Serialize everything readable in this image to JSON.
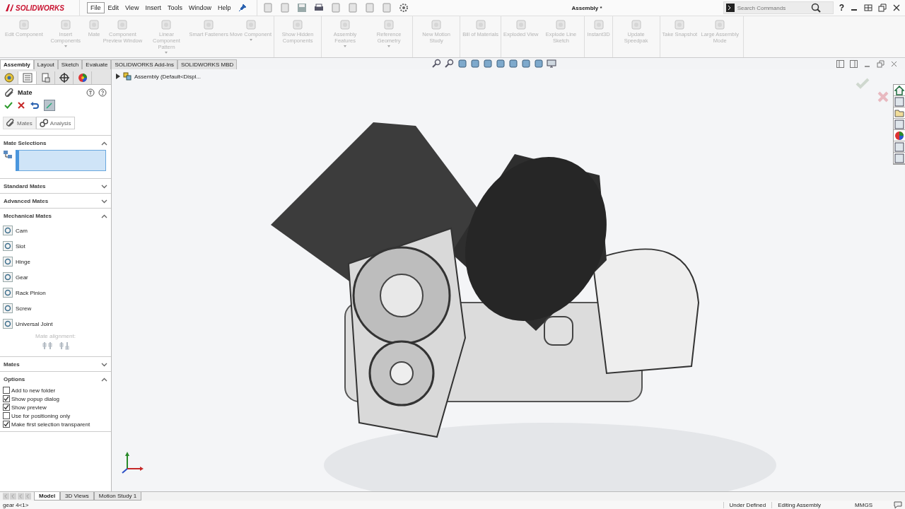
{
  "app": {
    "logo": "SOLIDWORKS",
    "document_title": "Assembly *",
    "help": "?"
  },
  "menus": [
    {
      "label": "File",
      "selected": true
    },
    {
      "label": "Edit",
      "selected": false
    },
    {
      "label": "View",
      "selected": false
    },
    {
      "label": "Insert",
      "selected": false
    },
    {
      "label": "Tools",
      "selected": false
    },
    {
      "label": "Window",
      "selected": false
    },
    {
      "label": "Help",
      "selected": false
    }
  ],
  "search": {
    "placeholder": "Search Commands"
  },
  "ribbon": {
    "groups": [
      {
        "buttons": [
          {
            "label": "Edit Component",
            "dropdown": false,
            "disabled": true
          },
          {
            "label": "Insert Components",
            "dropdown": true,
            "disabled": true
          },
          {
            "label": "Mate",
            "dropdown": false,
            "disabled": true
          },
          {
            "label": "Component Preview Window",
            "dropdown": false,
            "disabled": true
          },
          {
            "label": "Linear Component Pattern",
            "dropdown": true,
            "disabled": true
          },
          {
            "label": "Smart Fasteners",
            "dropdown": false,
            "disabled": true
          },
          {
            "label": "Move Component",
            "dropdown": true,
            "disabled": true
          }
        ]
      },
      {
        "buttons": [
          {
            "label": "Show Hidden Components",
            "dropdown": false,
            "disabled": true
          }
        ]
      },
      {
        "buttons": [
          {
            "label": "Assembly Features",
            "dropdown": true,
            "disabled": true
          },
          {
            "label": "Reference Geometry",
            "dropdown": true,
            "disabled": true
          }
        ]
      },
      {
        "buttons": [
          {
            "label": "New Motion Study",
            "dropdown": false,
            "disabled": true
          }
        ]
      },
      {
        "buttons": [
          {
            "label": "Bill of Materials",
            "dropdown": false,
            "disabled": true
          }
        ]
      },
      {
        "buttons": [
          {
            "label": "Exploded View",
            "dropdown": false,
            "disabled": true
          },
          {
            "label": "Explode Line Sketch",
            "dropdown": false,
            "disabled": true
          }
        ]
      },
      {
        "buttons": [
          {
            "label": "Instant3D",
            "dropdown": false,
            "disabled": true
          }
        ]
      },
      {
        "buttons": [
          {
            "label": "Update Speedpak",
            "dropdown": false,
            "disabled": true
          }
        ]
      },
      {
        "buttons": [
          {
            "label": "Take Snapshot",
            "dropdown": false,
            "disabled": true
          },
          {
            "label": "Large Assembly Mode",
            "dropdown": false,
            "disabled": true
          }
        ]
      }
    ]
  },
  "command_tabs": [
    {
      "label": "Assembly",
      "selected": true
    },
    {
      "label": "Layout",
      "selected": false
    },
    {
      "label": "Sketch",
      "selected": false
    },
    {
      "label": "Evaluate",
      "selected": false
    },
    {
      "label": "SOLIDWORKS Add-Ins",
      "selected": false
    },
    {
      "label": "SOLIDWORKS MBD",
      "selected": false
    }
  ],
  "tree": {
    "root": "Assembly  (Default<Displ..."
  },
  "property_manager": {
    "panel_tabs": [
      {
        "selected": false
      },
      {
        "selected": true
      },
      {
        "selected": false
      },
      {
        "selected": false
      },
      {
        "selected": false
      }
    ],
    "title": "Mate",
    "subtabs": [
      {
        "label": "Mates",
        "selected": true
      },
      {
        "label": "Analysis",
        "selected": false
      }
    ],
    "sections": [
      {
        "kind": "selection",
        "title": "Mate Selections",
        "expanded": true
      },
      {
        "title": "Standard Mates",
        "expanded": false
      },
      {
        "title": "Advanced Mates",
        "expanded": false
      },
      {
        "kind": "list",
        "title": "Mechanical Mates",
        "expanded": true,
        "items": [
          "Cam",
          "Slot",
          "Hinge",
          "Gear",
          "Rack Pinion",
          "Screw",
          "Universal Joint"
        ],
        "alignment_label": "Mate alignment:"
      },
      {
        "title": "Mates",
        "expanded": false
      },
      {
        "kind": "options",
        "title": "Options",
        "expanded": true,
        "options": [
          {
            "label": "Add to new folder",
            "checked": false
          },
          {
            "label": "Show popup dialog",
            "checked": true
          },
          {
            "label": "Show preview",
            "checked": true
          },
          {
            "label": "Use for positioning only",
            "checked": false
          },
          {
            "label": "Make first selection transparent",
            "checked": true
          }
        ]
      }
    ]
  },
  "bottom_tabs": [
    {
      "label": "Model",
      "selected": true
    },
    {
      "label": "3D Views",
      "selected": false
    },
    {
      "label": "Motion Study 1",
      "selected": false
    }
  ],
  "status_bar": {
    "message": "gear 4<1>",
    "state": "Under Defined",
    "mode": "Editing Assembly",
    "units": "MMGS"
  }
}
